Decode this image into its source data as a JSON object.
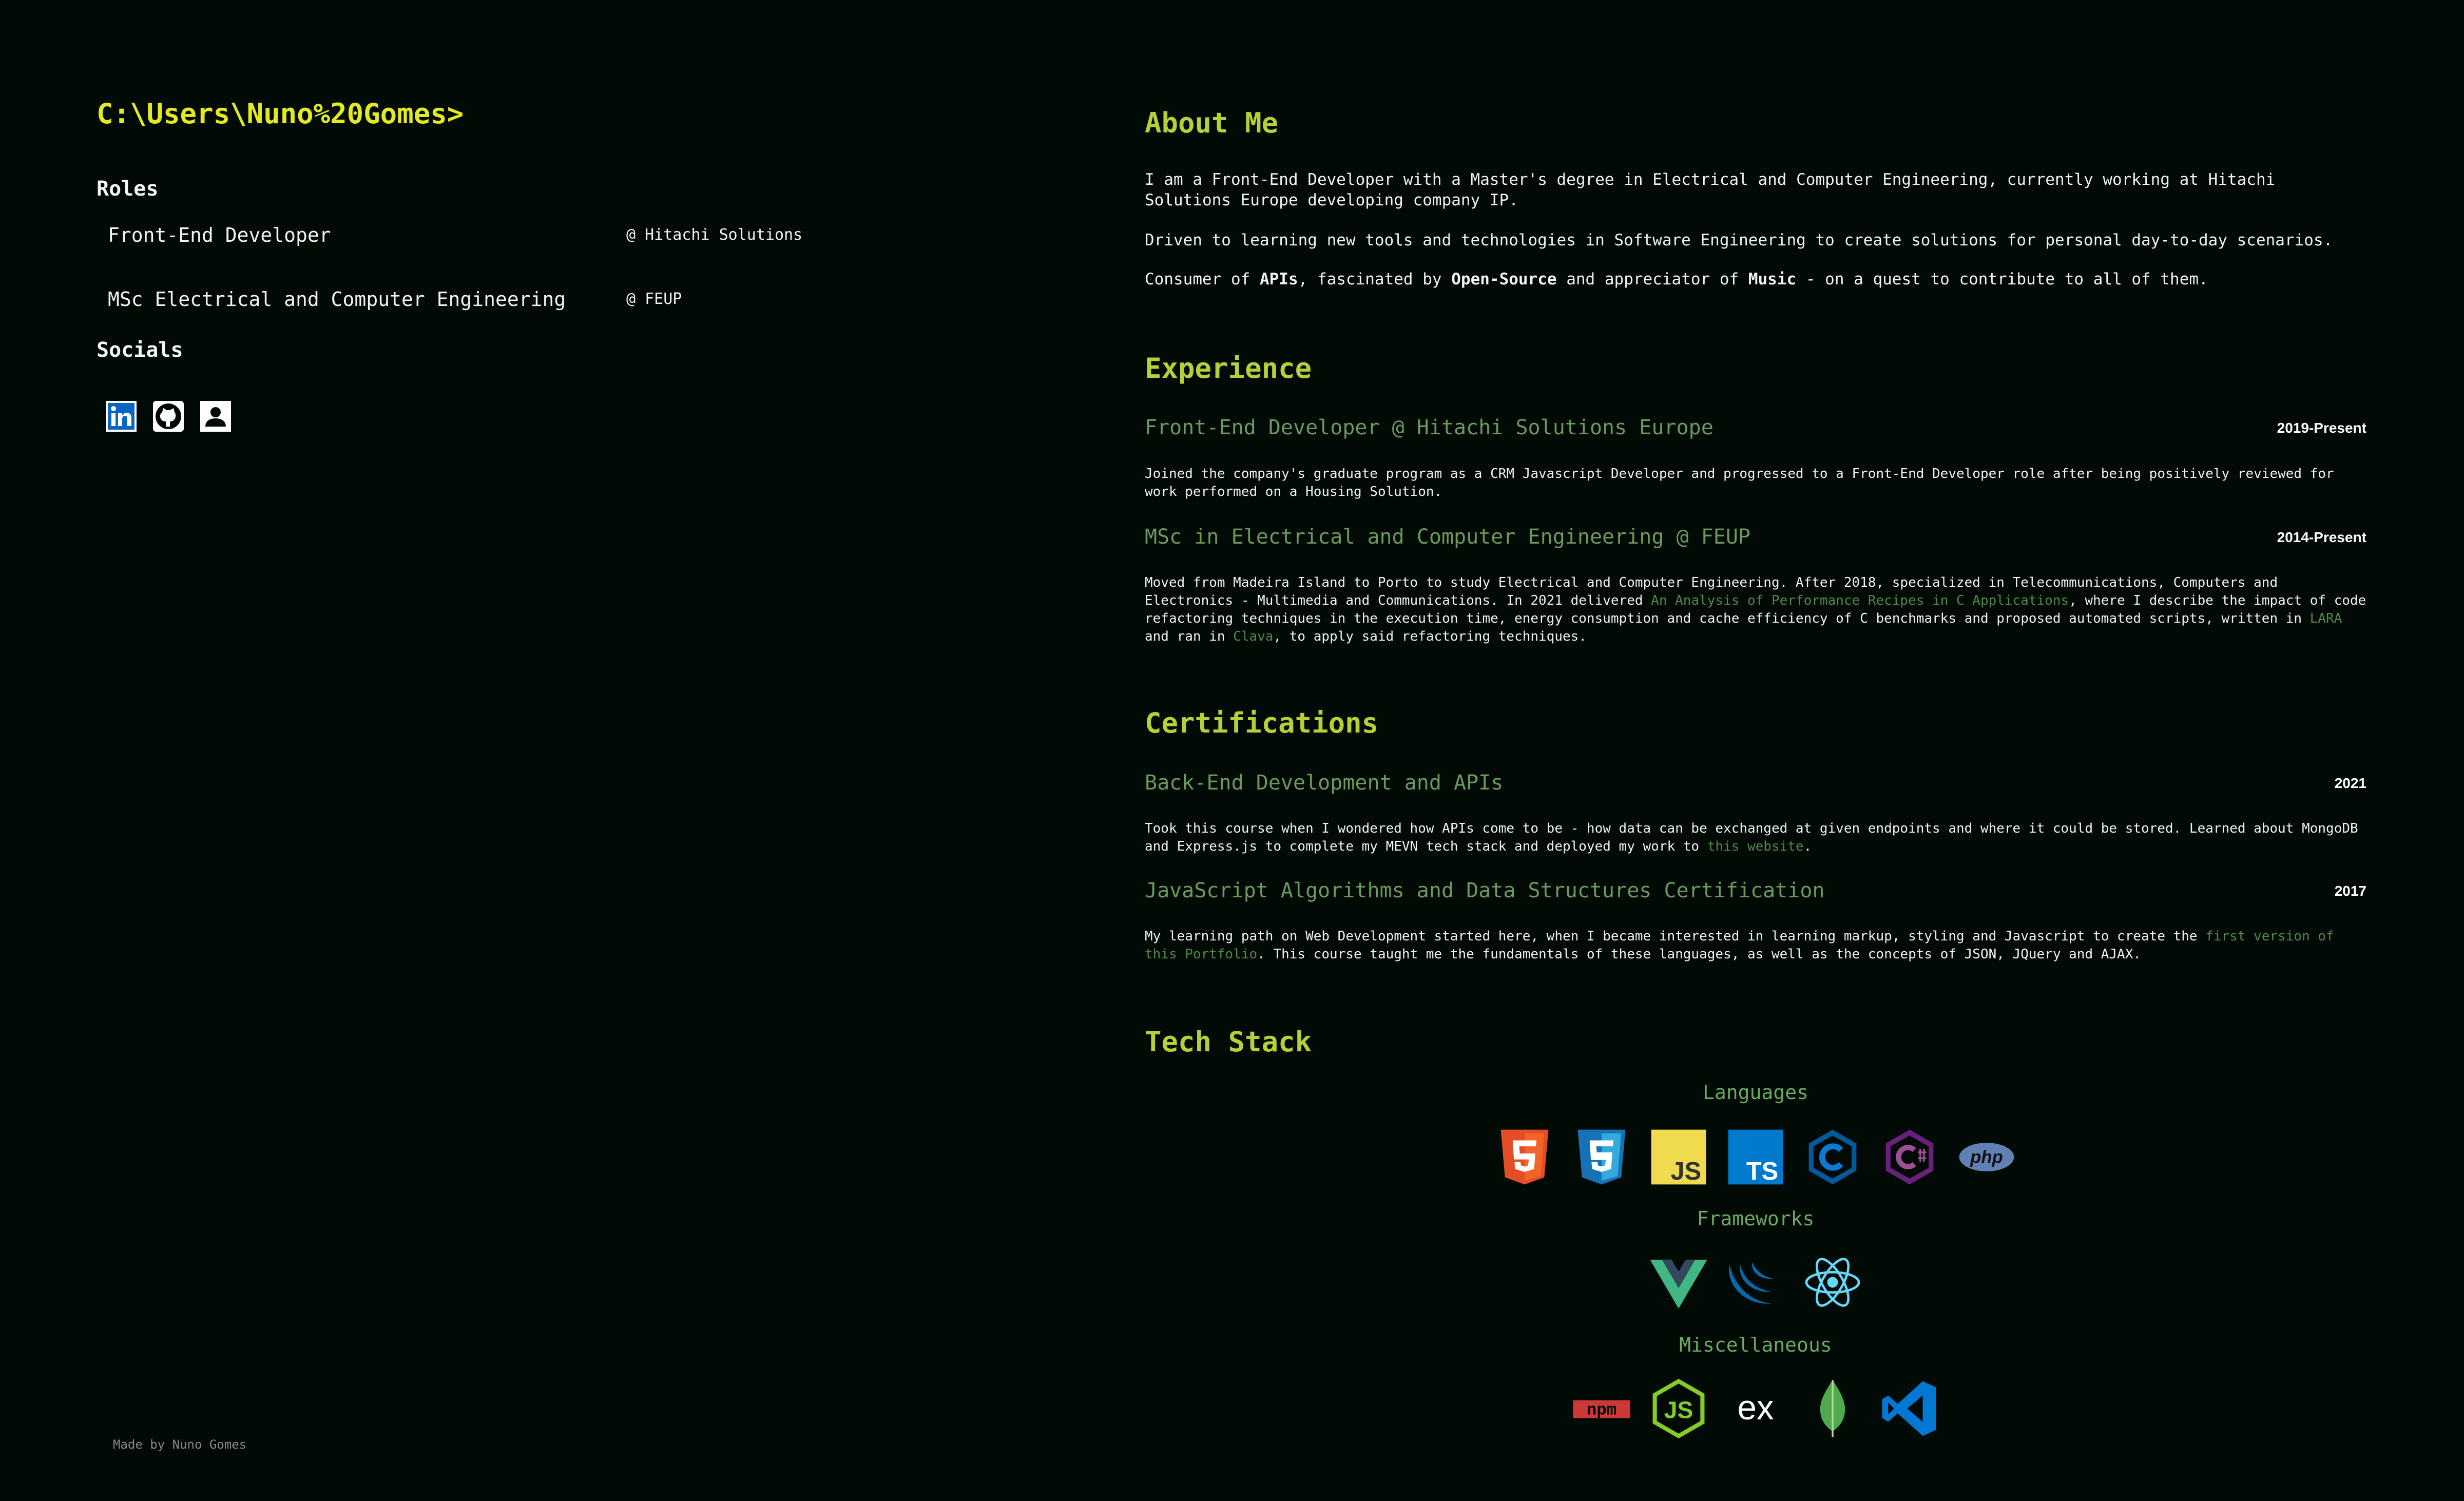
{
  "left": {
    "prompt": "C:\\Users\\Nuno%20Gomes>",
    "roles_heading": "Roles",
    "roles": [
      {
        "title": "Front-End Developer",
        "org": "@ Hitachi Solutions"
      },
      {
        "title": "MSc Electrical and Computer Engineering",
        "org": "@ FEUP"
      }
    ],
    "socials_heading": "Socials",
    "socials": [
      "linkedin-icon",
      "github-icon",
      "contact-icon"
    ],
    "footer": "Made by Nuno Gomes"
  },
  "about": {
    "heading": "About Me",
    "p1": "I am a Front-End Developer with a Master's degree in Electrical and Computer Engineering, currently working at Hitachi Solutions Europe developing company IP.",
    "p2": "Driven to learning new tools and technologies in Software Engineering to create solutions for personal day-to-day scenarios.",
    "p3_a": "Consumer of ",
    "p3_b": "APIs",
    "p3_c": ", fascinated by ",
    "p3_d": "Open-Source",
    "p3_e": " and appreciator of ",
    "p3_f": "Music",
    "p3_g": " - on a quest to contribute to all of them."
  },
  "experience": {
    "heading": "Experience",
    "items": [
      {
        "title": "Front-End Developer @ Hitachi Solutions Europe",
        "date": "2019-Present",
        "desc": "Joined the company's graduate program as a CRM Javascript Developer and progressed to a Front-End Developer role after being positively reviewed for work performed on a Housing Solution."
      },
      {
        "title": "MSc in Electrical and Computer Engineering @ FEUP",
        "date": "2014-Present",
        "desc_a": "Moved from Madeira Island to Porto to study Electrical and Computer Engineering. After 2018, specialized in Telecommunications, Computers and Electronics - Multimedia and Communications. In 2021 delivered ",
        "link1": "An Analysis of Performance Recipes in C Applications",
        "desc_b": ", where I describe the impact of code refactoring techniques in the execution time, energy consumption and cache efficiency of C benchmarks and proposed automated scripts, written in ",
        "link2": "LARA",
        "desc_c": " and ran in ",
        "link3": "Clava",
        "desc_d": ", to apply said refactoring techniques."
      }
    ]
  },
  "certifications": {
    "heading": "Certifications",
    "items": [
      {
        "title": "Back-End Development and APIs",
        "date": "2021",
        "desc_a": "Took this course when I wondered how APIs come to be - how data can be exchanged at given endpoints and where it could be stored. Learned about MongoDB and Express.js to complete my MEVN tech stack and deployed my work to ",
        "link": "this website",
        "desc_b": "."
      },
      {
        "title": "JavaScript Algorithms and Data Structures Certification",
        "date": "2017",
        "desc_a": "My learning path on Web Development started here, when I became interested in learning markup, styling and Javascript to create the ",
        "link": "first version of this Portfolio",
        "desc_b": ". This course taught me the fundamentals of these languages, as well as the concepts of JSON, JQuery and AJAX."
      }
    ]
  },
  "tech": {
    "heading": "Tech Stack",
    "languages_label": "Languages",
    "frameworks_label": "Frameworks",
    "misc_label": "Miscellaneous",
    "languages": [
      "html5-icon",
      "css3-icon",
      "javascript-icon",
      "typescript-icon",
      "c-icon",
      "csharp-icon",
      "php-icon"
    ],
    "frameworks": [
      "vue-icon",
      "jquery-icon",
      "react-icon"
    ],
    "misc": [
      "npm-icon",
      "nodejs-icon",
      "express-icon",
      "mongodb-icon",
      "vscode-icon"
    ],
    "icon_text": {
      "ts": "TS",
      "js": "JS",
      "php": "php",
      "npm": "npm",
      "ex": "ex"
    }
  },
  "colors": {
    "background": "#020a05",
    "prompt": "#e4ea1e",
    "heading": "#b6d036",
    "entry_title": "#6a9a5e",
    "link": "#4f8a4a"
  }
}
